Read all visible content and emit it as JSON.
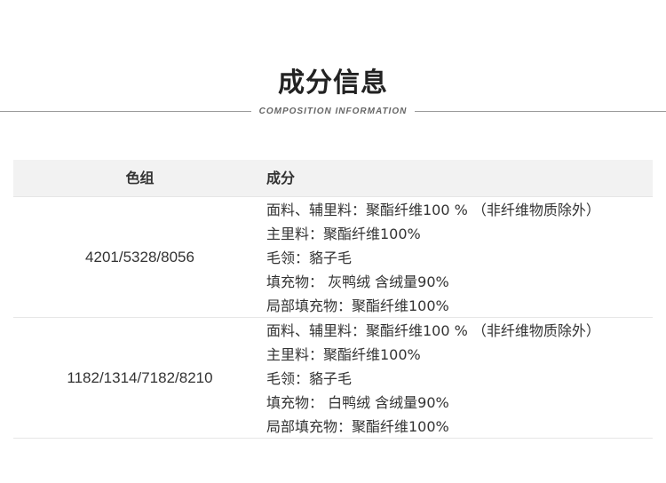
{
  "section": {
    "title": "成分信息",
    "subtitle": "COMPOSITION INFORMATION"
  },
  "table": {
    "headers": [
      "色组",
      "成分"
    ],
    "rows": [
      {
        "color_group": "4201/5328/8056",
        "composition": [
          "面料、辅里料：聚酯纤维100 % （非纤维物质除外）",
          "主里料：聚酯纤维100%",
          "毛领：貉子毛",
          "填充物： 灰鸭绒 含绒量90%",
          "局部填充物：聚酯纤维100%"
        ]
      },
      {
        "color_group": "1182/1314/7182/8210",
        "composition": [
          "面料、辅里料：聚酯纤维100 % （非纤维物质除外）",
          "主里料：聚酯纤维100%",
          "毛领：貉子毛",
          "填充物： 白鸭绒 含绒量90%",
          "局部填充物：聚酯纤维100%"
        ]
      }
    ]
  }
}
